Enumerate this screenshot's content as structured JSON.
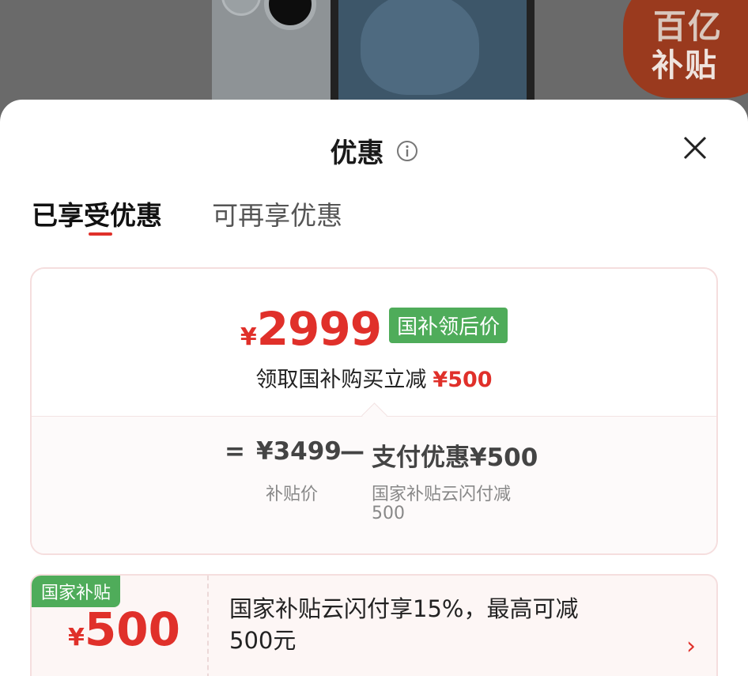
{
  "backdrop": {
    "badge_line1": "百亿",
    "badge_line2": "补贴"
  },
  "sheet": {
    "title": "优惠",
    "tabs": [
      {
        "label": "已享受优惠"
      },
      {
        "label": "可再享优惠"
      }
    ],
    "summary": {
      "currency": "¥",
      "final_price": "2999",
      "price_tag": "国补领后价",
      "claim_text": "领取国补购买立减",
      "claim_amount": "¥500",
      "equals": "=",
      "base_price": "¥3499",
      "base_label": "补贴价",
      "minus": "—",
      "discount_text": "支付优惠¥500",
      "discount_label_line1": "国家补贴云闪付减",
      "discount_label_line2": "500"
    },
    "coupon": {
      "tag": "国家补贴",
      "currency": "¥",
      "amount": "500",
      "desc_line1": "国家补贴云闪付享15%，最高可减",
      "desc_line2": "500元",
      "chevron": "›"
    }
  },
  "colors": {
    "accent_red": "#e0302a",
    "tag_green": "#4fac5a"
  },
  "icons": [
    "info-icon",
    "close-icon",
    "chevron-right-icon"
  ]
}
